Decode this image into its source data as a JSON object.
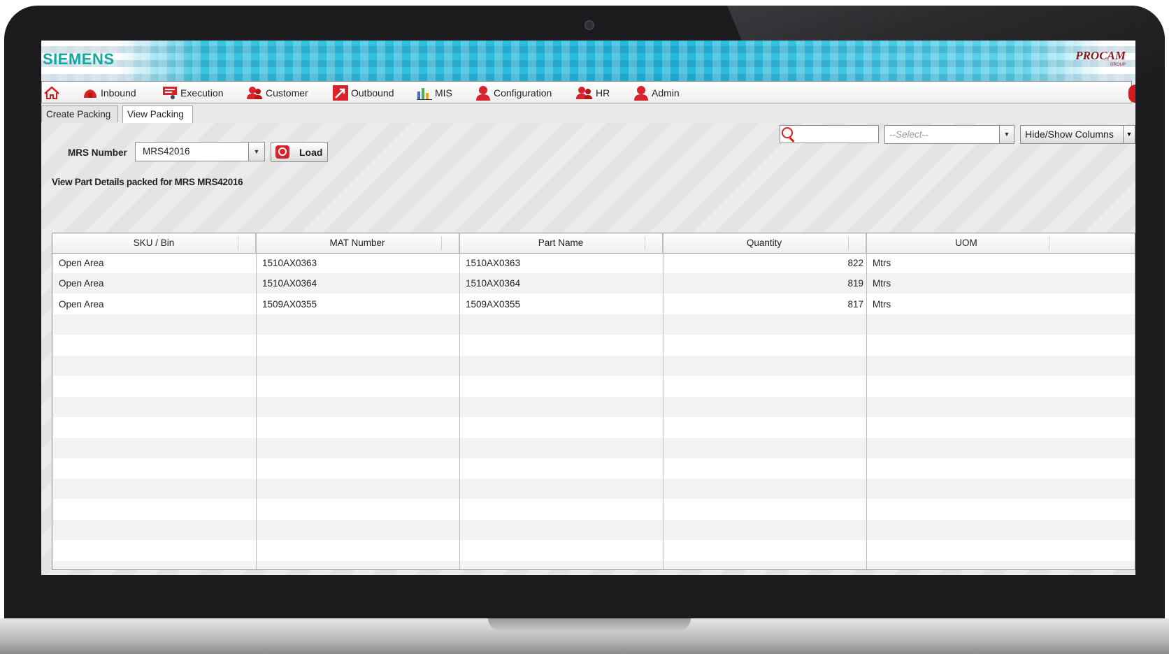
{
  "app": {
    "brand_left": "SIEMENS",
    "brand_right": "PROCAM",
    "brand_right_sub": "GROUP"
  },
  "menu": {
    "items": [
      {
        "label": "",
        "icon": "home-icon"
      },
      {
        "label": "Inbound",
        "icon": "inbound-icon"
      },
      {
        "label": "Execution",
        "icon": "execution-icon"
      },
      {
        "label": "Customer",
        "icon": "customer-icon"
      },
      {
        "label": "Outbound",
        "icon": "outbound-icon"
      },
      {
        "label": "MIS",
        "icon": "chart-icon"
      },
      {
        "label": "Configuration",
        "icon": "user-icon"
      },
      {
        "label": "HR",
        "icon": "hr-icon"
      },
      {
        "label": "Admin",
        "icon": "user-icon"
      }
    ]
  },
  "tabs": [
    {
      "label": "Create Packing",
      "active": false
    },
    {
      "label": "View Packing",
      "active": true
    }
  ],
  "form": {
    "mrs_label": "MRS Number",
    "mrs_value": "MRS42016",
    "load_label": "Load"
  },
  "grid": {
    "caption": "View Part Details packed for MRS MRS42016",
    "search_value": "",
    "filter_placeholder": "--Select--",
    "hide_show_label": "Hide/Show Columns",
    "columns": [
      "SKU / Bin",
      "MAT Number",
      "Part Name",
      "Quantity",
      "UOM"
    ],
    "rows": [
      [
        "Open Area",
        "1510AX0363",
        "1510AX0363",
        "822",
        "Mtrs"
      ],
      [
        "Open Area",
        "1510AX0364",
        "1510AX0364",
        "819",
        "Mtrs"
      ],
      [
        "Open Area",
        "1509AX0355",
        "1509AX0355",
        "817",
        "Mtrs"
      ]
    ]
  },
  "colors": {
    "brand_teal": "#13a89e",
    "banner_cyan": "#25b8dc",
    "accent_red": "#d8232a",
    "procam_red": "#8a1b23"
  }
}
